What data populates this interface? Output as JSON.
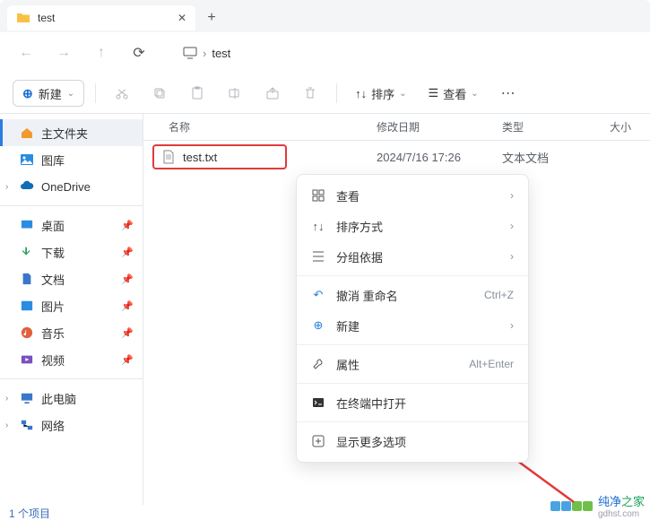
{
  "tab": {
    "title": "test"
  },
  "pathbar": {
    "segment": "test"
  },
  "toolbar": {
    "new_label": "新建",
    "sort_label": "排序",
    "view_label": "查看"
  },
  "sidebar": {
    "home": "主文件夹",
    "gallery": "图库",
    "onedrive": "OneDrive",
    "desktop": "桌面",
    "downloads": "下载",
    "documents": "文档",
    "pictures": "图片",
    "music": "音乐",
    "videos": "视频",
    "thispc": "此电脑",
    "network": "网络"
  },
  "columns": {
    "name": "名称",
    "date": "修改日期",
    "type": "类型",
    "size": "大小"
  },
  "file": {
    "name": "test.txt",
    "date": "2024/7/16 17:26",
    "type": "文本文档"
  },
  "context": {
    "view": "查看",
    "sort": "排序方式",
    "group": "分组依据",
    "undo": "撤消 重命名",
    "undo_sc": "Ctrl+Z",
    "new": "新建",
    "props": "属性",
    "props_sc": "Alt+Enter",
    "terminal": "在终端中打开",
    "more": "显示更多选项"
  },
  "status": {
    "text": "1 个项目"
  },
  "watermark": {
    "name_a": "纯净",
    "name_b": "之家",
    "url": "gdhst.com"
  }
}
